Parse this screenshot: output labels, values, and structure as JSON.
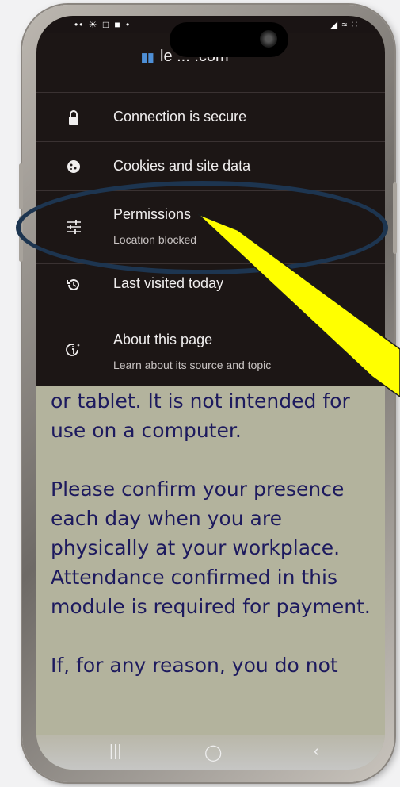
{
  "status_bar": {
    "left": "•• ☀ □ ■ •",
    "right": "◢ ≈ ∷"
  },
  "url_bar": {
    "domain": "le  ... .com"
  },
  "menu": {
    "items": [
      {
        "icon": "lock-icon",
        "title": "Connection is secure",
        "subtitle": ""
      },
      {
        "icon": "cookie-icon",
        "title": "Cookies and site data",
        "subtitle": ""
      },
      {
        "icon": "tune-icon",
        "title": "Permissions",
        "subtitle": "Location blocked"
      },
      {
        "icon": "history-icon",
        "title": "Last visited today",
        "subtitle": ""
      },
      {
        "icon": "info-sparkle-icon",
        "title": "About this page",
        "subtitle": "Learn about its source and topic"
      }
    ]
  },
  "page": {
    "paragraph_1": "or tablet. It is not intended for use on a computer.",
    "paragraph_2": "Please confirm your presence each day when you are physically at your workplace. Attendance confirmed in this module is required for payment.",
    "paragraph_3_partial": "If, for any reason, you do not"
  },
  "nav_bar": {
    "recents": "|||",
    "home": "◯",
    "back": "‹"
  },
  "colors": {
    "popup_bg": "#1c1615",
    "page_bg": "#b3b39d",
    "page_text": "#1d1a5e",
    "annotation_ellipse": "#1d3550",
    "annotation_arrow": "#ffff00"
  }
}
